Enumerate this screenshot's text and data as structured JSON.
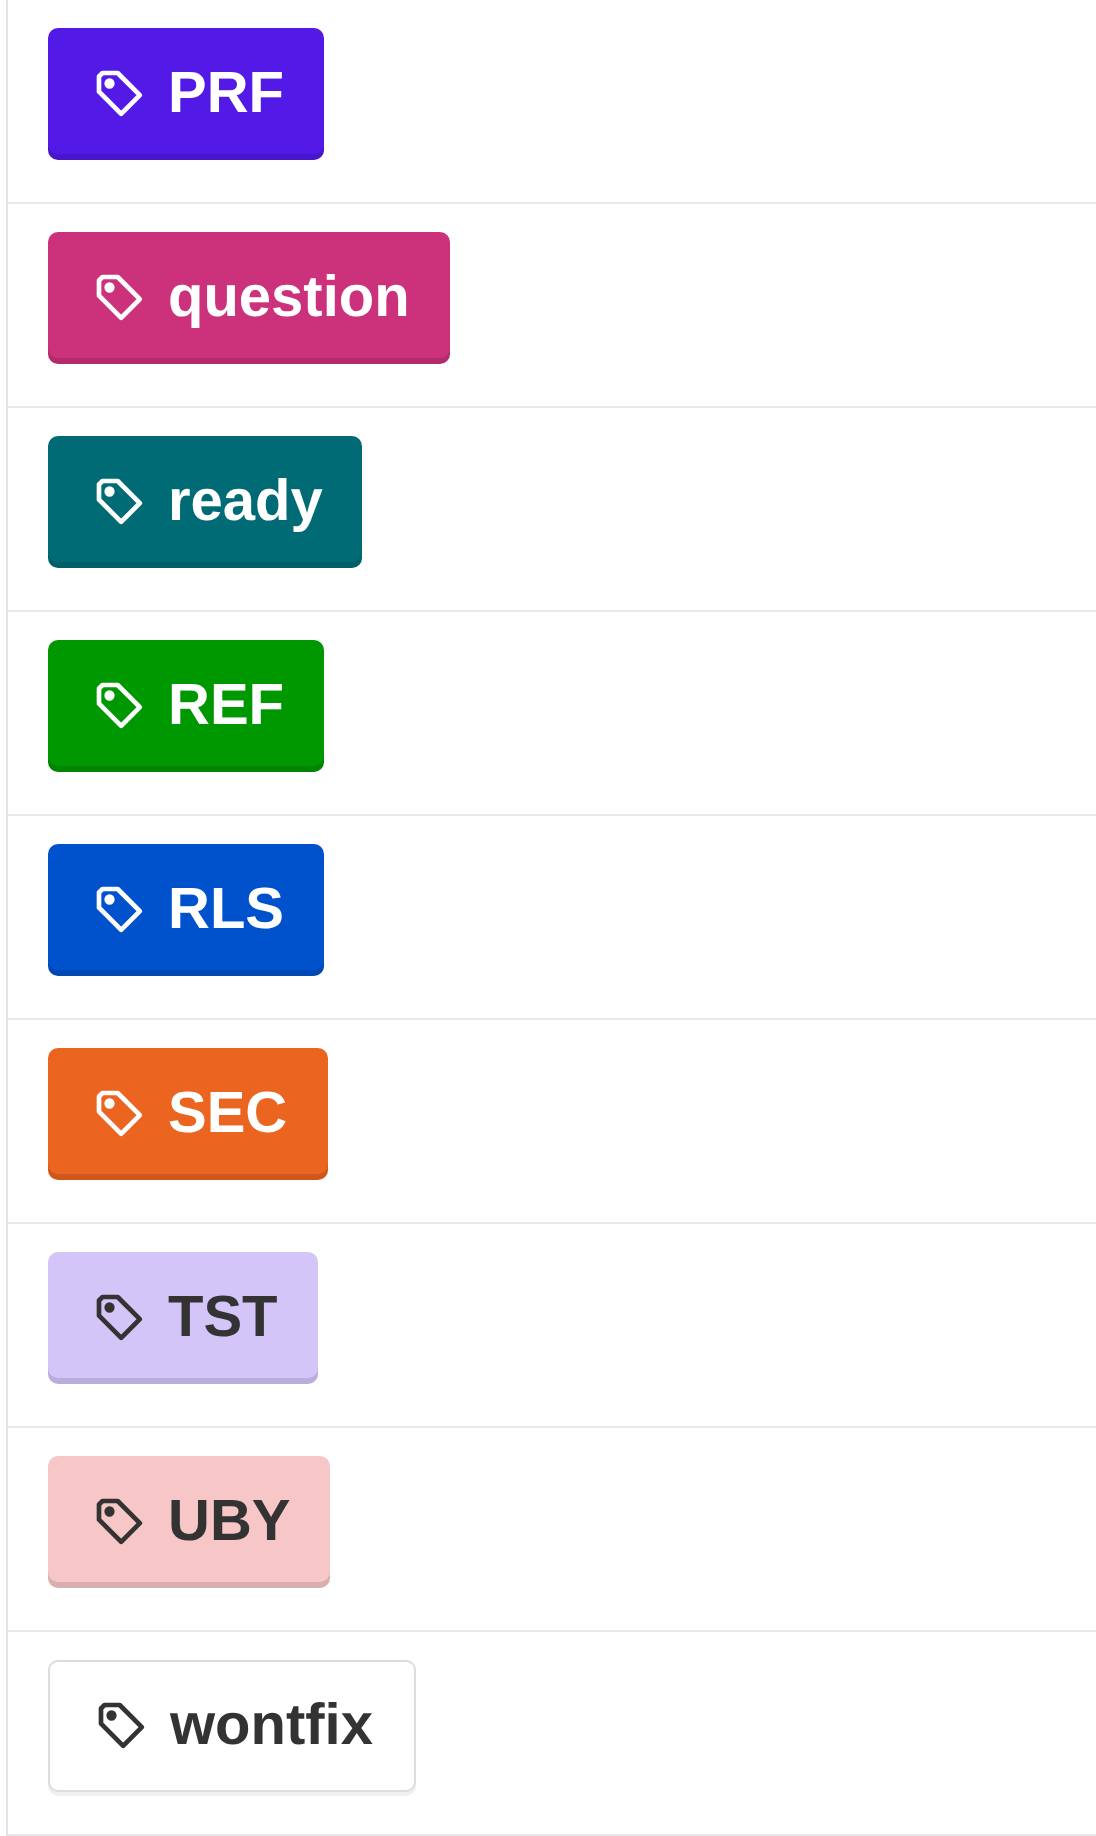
{
  "labels": [
    {
      "name": "PRF",
      "color": "#5319e7"
    },
    {
      "name": "question",
      "color": "#cc317c"
    },
    {
      "name": "ready",
      "color": "#006b75"
    },
    {
      "name": "REF",
      "color": "#009800"
    },
    {
      "name": "RLS",
      "color": "#0052cc"
    },
    {
      "name": "SEC",
      "color": "#eb6420"
    },
    {
      "name": "TST",
      "color": "#d4c5f9"
    },
    {
      "name": "UBY",
      "color": "#f7c6c7"
    },
    {
      "name": "wontfix",
      "color": "#ffffff"
    }
  ]
}
